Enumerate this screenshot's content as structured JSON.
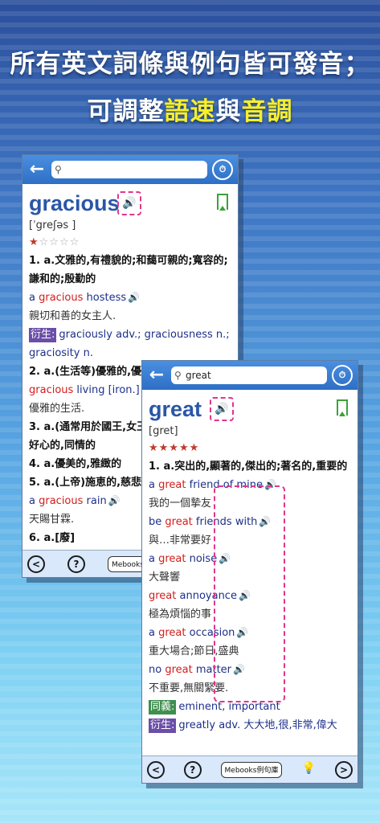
{
  "headline": {
    "line1": "所有英文詞條與例句皆可發音；",
    "line2_prefix": "可調整",
    "line2_hl1": "語速",
    "line2_mid": "與",
    "line2_hl2": "音調"
  },
  "icons": {
    "back": "back-arrow-icon",
    "search": "search-icon",
    "speed": "speed-pitch-icon",
    "speaker": "speaker-icon",
    "bookmark": "bookmark-icon"
  },
  "colors": {
    "accent": "#2d6fc6",
    "highlight": "#f7ef2a",
    "red": "#d21d1d",
    "dash": "#e0358d"
  },
  "card1": {
    "search_value": "",
    "word": "gracious",
    "phonetic": "[ˈgreʃəs ]",
    "stars_on": 1,
    "stars_total": 5,
    "def1": "1. a.文雅的,有禮貌的;和藹可親的;寬容的;謙和的;殷勤的",
    "ex1_a": "a ",
    "ex1_b": "gracious",
    "ex1_c": " hostess",
    "tr1": "親切和善的女主人.",
    "deriv_tag": "衍生:",
    "deriv_text": "graciously adv.; graciousness n.; graciosity n.",
    "def2": "2. a.(生活等)優雅的,優",
    "ex2_a": "gracious",
    "ex2_b": " living [iron.]",
    "tr2": "優雅的生活.",
    "def3": "3. a.(通常用於國王,女王",
    "def3b": "好心的,同情的",
    "def4": "4. a.優美的,雅緻的",
    "def5": "5. a.(上帝)施恵的,慈悲",
    "ex5_a": "a ",
    "ex5_b": "gracious",
    "ex5_c": " rain",
    "tr5": "天賜甘霖.",
    "def6": "6. a.[廢]",
    "btn_prev": "<",
    "btn_help": "?",
    "btn_mebooks": "Mebooks例句"
  },
  "card2": {
    "search_value": "great",
    "word": "great",
    "phonetic": "[gret]",
    "stars_on": 5,
    "stars_total": 5,
    "def1": "1. a.突出的,顯著的,傑出的;著名的,重要的",
    "examples": [
      {
        "pre": "a ",
        "hl": "great",
        "post": " friend of mine",
        "tr": "我的一個摯友"
      },
      {
        "pre": "be ",
        "hl": "great",
        "post": " friends with",
        "tr": "與…非常要好"
      },
      {
        "pre": "a ",
        "hl": "great",
        "post": " noise",
        "tr": "大聲響"
      },
      {
        "pre": "",
        "hl": "great",
        "post": " annoyance",
        "tr": "極為煩惱的事"
      },
      {
        "pre": "a ",
        "hl": "great",
        "post": " occasion",
        "tr": "重大場合;節日,盛典"
      },
      {
        "pre": "no ",
        "hl": "great",
        "post": " matter",
        "tr": "不重要,無關緊要."
      }
    ],
    "syn_tag": "同義:",
    "syn_text": "eminent, important",
    "deriv_tag": "衍生:",
    "deriv_text": "greatly adv. 大大地,很,非常,偉大",
    "btn_prev": "<",
    "btn_help": "?",
    "btn_mebooks": "Mebooks例句庫",
    "btn_next": ">"
  }
}
